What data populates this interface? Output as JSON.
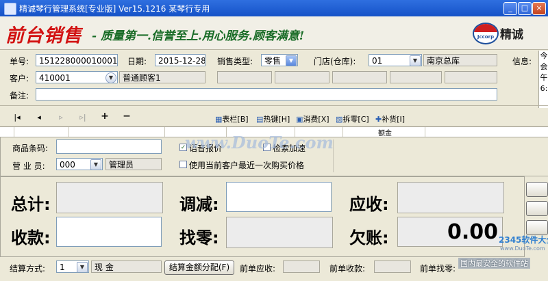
{
  "window": {
    "title": "精诚琴行管理系统[专业版]  Ver15.1216    某琴行专用",
    "min": "_",
    "max": "□",
    "close": "×"
  },
  "banner": {
    "big": "前台销售",
    "slogan": "- 质量第一.信誉至上.用心服务.顾客满意!",
    "brand": "精诚",
    "logo_text": "Jccorp"
  },
  "form": {
    "order_no_label": "单号:",
    "order_no": "151228000010001",
    "date_label": "日期:",
    "date": "2015-12-28",
    "sale_type_label": "销售类型:",
    "sale_type": "零售",
    "store_label": "门店(仓库):",
    "store_code": "01",
    "store_name": "南京总库",
    "info_label": "信息:",
    "customer_label": "客户:",
    "customer_code": "410001",
    "customer_name": "普通顾客1",
    "remark_label": "备注:",
    "remark": ""
  },
  "side_info": [
    "今",
    "会",
    "午",
    "6:"
  ],
  "toolbar": {
    "nav": [
      "|◂",
      "◂",
      "▹",
      "▹|",
      "+",
      "−"
    ],
    "buttons": [
      "表栏[B]",
      "热键[H]",
      "消费[X]",
      "拆零[C]",
      "补货[I]"
    ]
  },
  "grid": {
    "col_amount": "额金"
  },
  "entry": {
    "barcode_label": "商品条码:",
    "barcode": "",
    "clerk_label": "营 业 员:",
    "clerk_code": "000",
    "clerk_name": "管理员",
    "voice_label": "语音报价",
    "voice_checked": "✓",
    "search_label": "检索加速",
    "lastprice_label": "使用当前客户最近一次购买价格"
  },
  "totals": {
    "total_label": "总计:",
    "adjust_label": "调减:",
    "receivable_label": "应收:",
    "paid_label": "收款:",
    "change_label": "找零:",
    "debt_label": "欠账:",
    "debt_value": "0.00"
  },
  "footer": {
    "settle_label": "结算方式:",
    "settle_code": "1",
    "settle_name": "现   金",
    "allocate_button": "结算金额分配(F)",
    "prev_receivable_label": "前单应收:",
    "prev_paid_label": "前单收款:",
    "prev_change_label": "前单找零:"
  },
  "watermarks": {
    "center": "www.DuoTe.com",
    "corner_logo": "2345软件大全",
    "corner_url": "www.DuoTe.com",
    "corner_slogan": "国内最安全的软件站"
  }
}
